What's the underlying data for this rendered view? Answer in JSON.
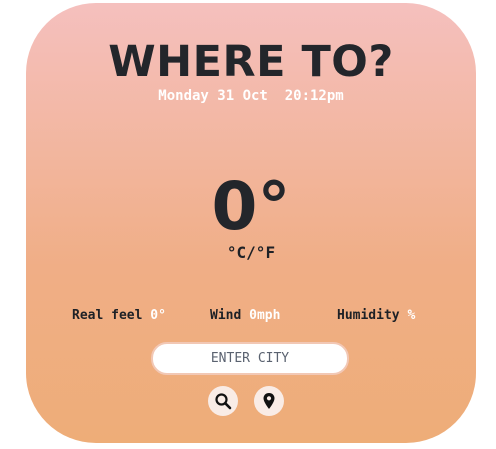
{
  "header": {
    "title": "WHERE TO?",
    "datetime": "Monday 31 Oct  20:12pm"
  },
  "weather": {
    "temperature": "0°",
    "unit_toggle": "°C/°F"
  },
  "stats": {
    "real_feel_label": "Real feel",
    "real_feel_value": "0°",
    "wind_label": "Wind",
    "wind_value": "0mph",
    "humidity_label": "Humidity",
    "humidity_value": "%"
  },
  "search": {
    "placeholder": "ENTER CITY"
  },
  "icons": {
    "search": "search-icon",
    "location": "location-pin-icon"
  },
  "colors": {
    "gradient_top": "#f5c0be",
    "gradient_bottom": "#eead78",
    "text_dark": "#23262b",
    "text_light": "#ffffff"
  }
}
